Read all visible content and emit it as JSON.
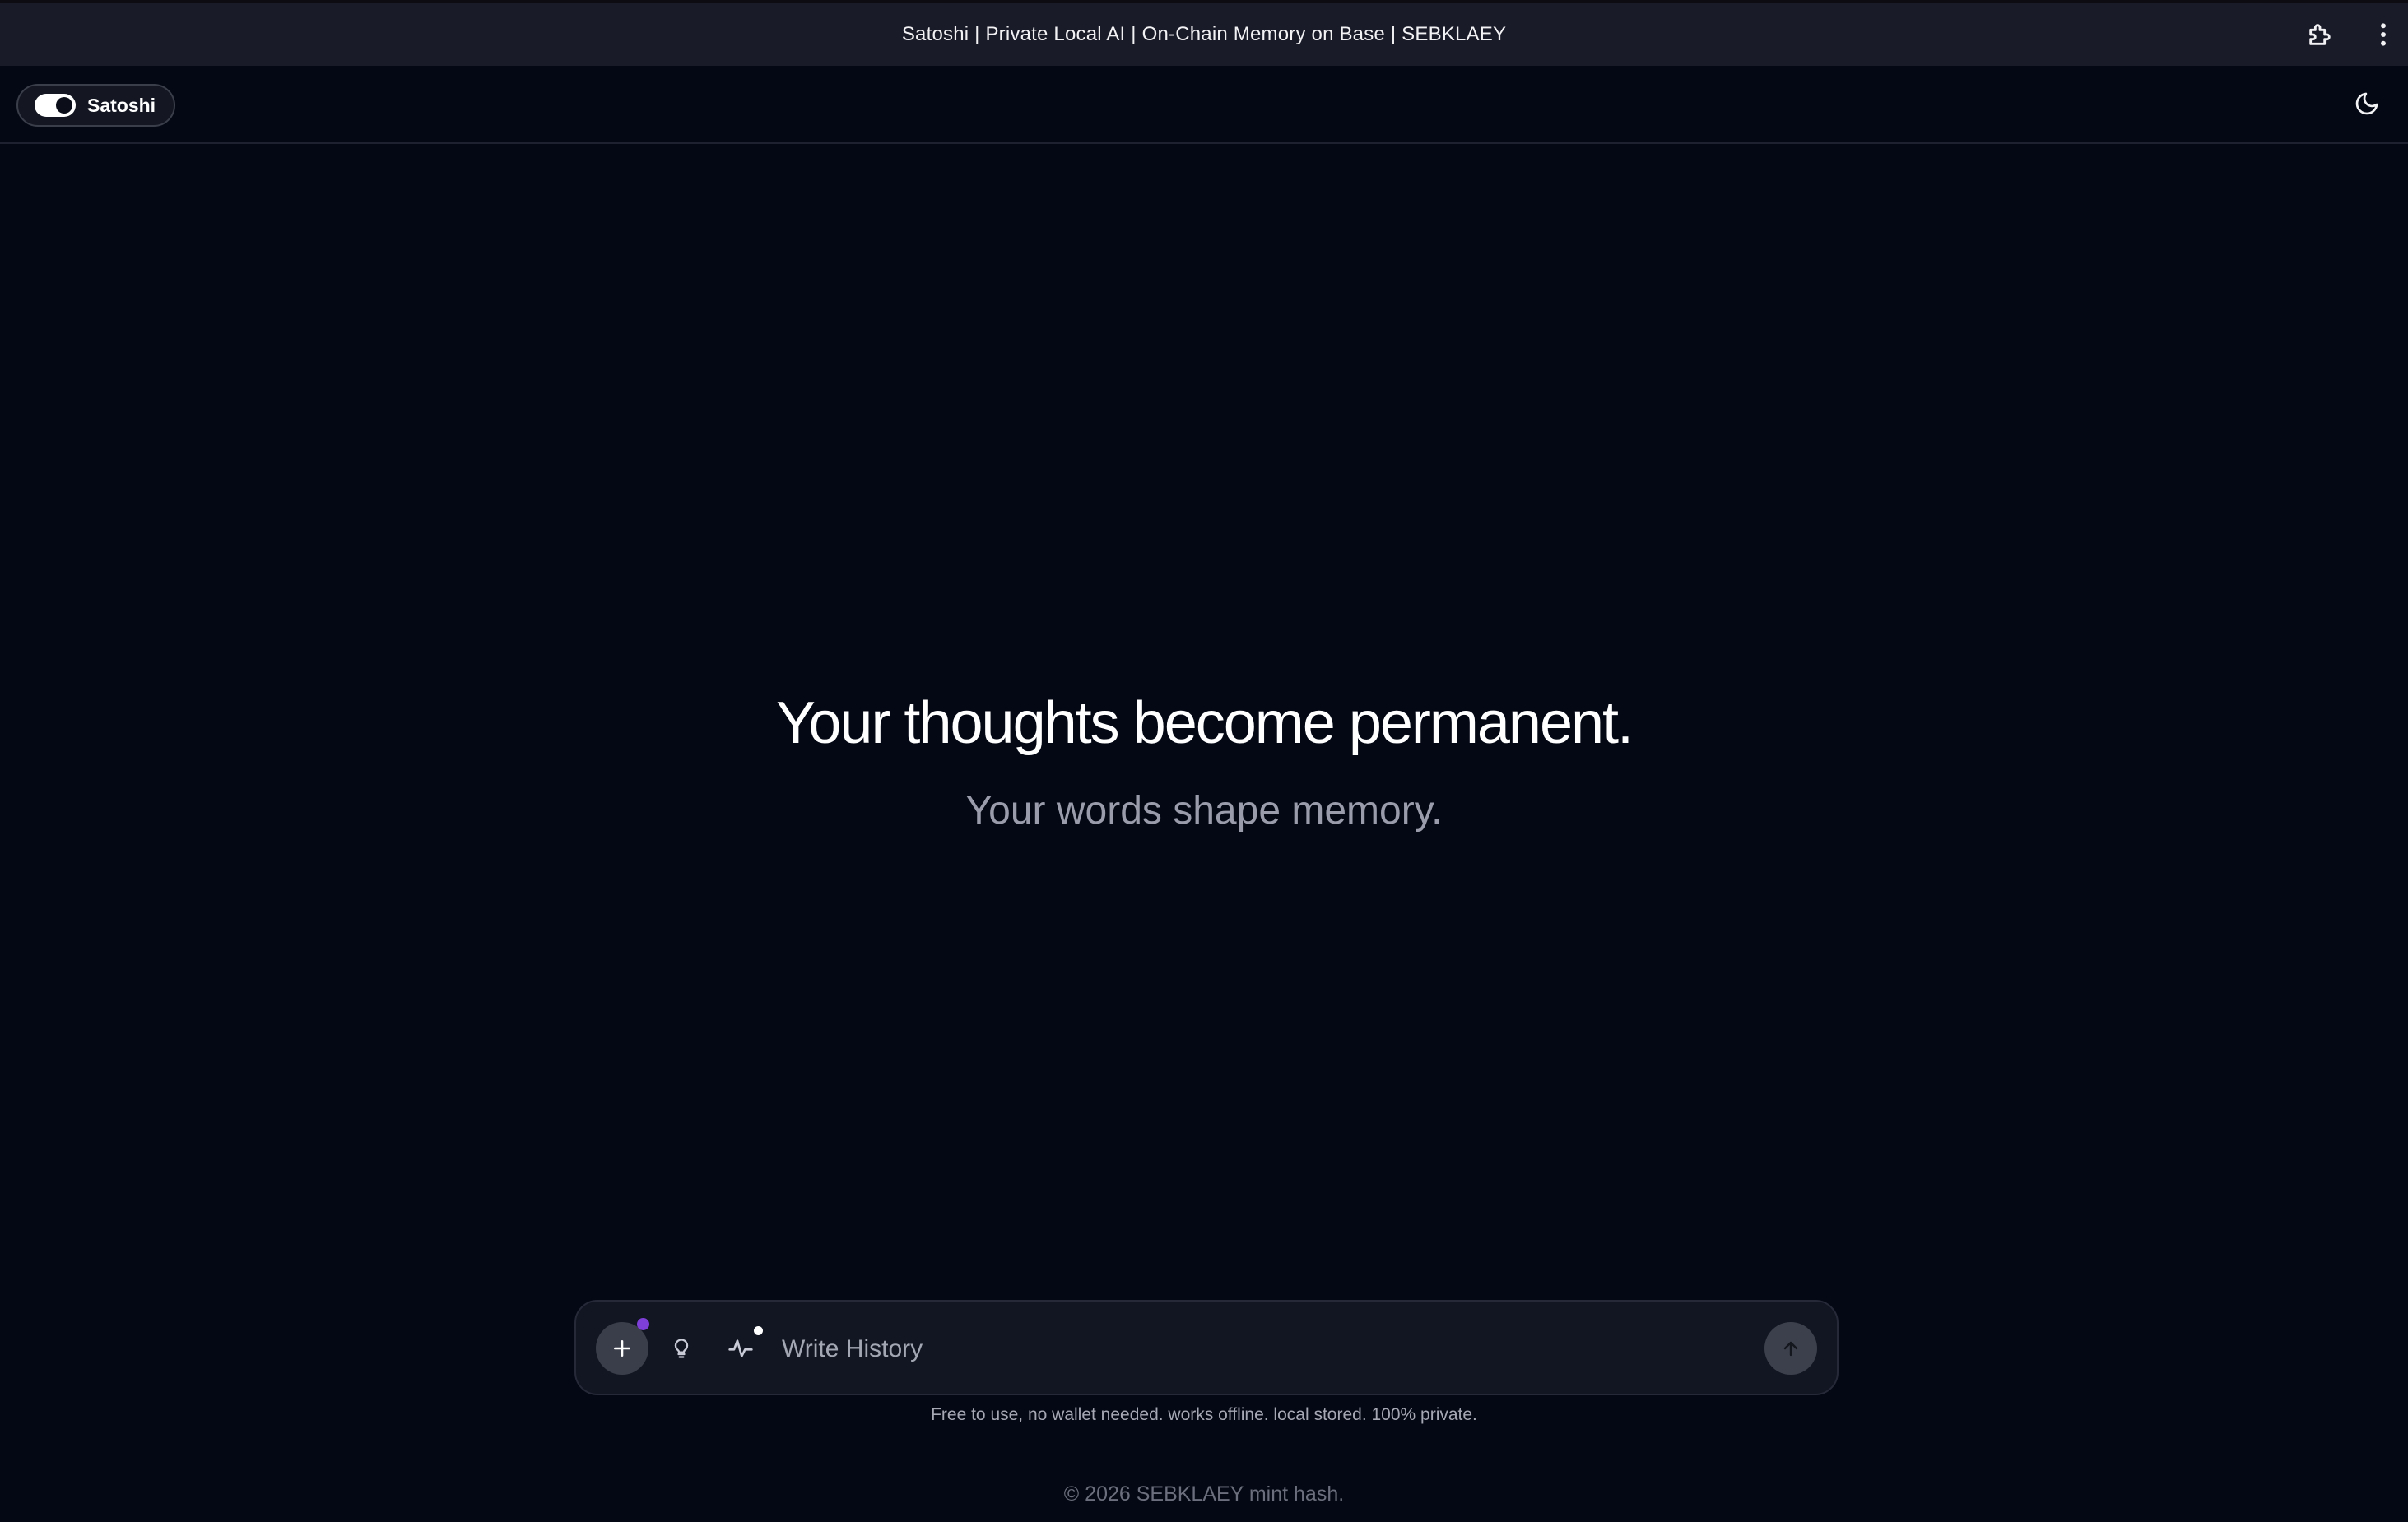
{
  "browser": {
    "title": "Satoshi | Private Local AI | On-Chain Memory on Base | SEBKLAEY",
    "icons": [
      "extension-puzzle-icon",
      "kebab-menu-icon"
    ]
  },
  "header": {
    "mode_label": "Satoshi",
    "mode_toggle_on": true,
    "theme_icon": "moon-icon"
  },
  "hero": {
    "title": "Your thoughts become permanent.",
    "subtitle": "Your words shape memory."
  },
  "composer": {
    "placeholder": "Write History",
    "value": "",
    "icons": [
      "plus-icon",
      "lightbulb-icon",
      "activity-pulse-icon",
      "arrow-up-icon"
    ],
    "plus_badge_color": "#7e3fd8"
  },
  "disclaimer": "Free to use, no wallet needed. works offline. local stored. 100% private.",
  "footer": "© 2026 SEBKLAEY mint hash.",
  "colors": {
    "background": "#040814",
    "titlebar": "#1a1b28",
    "composer": "#121623",
    "accent": "#7e3fd8"
  }
}
